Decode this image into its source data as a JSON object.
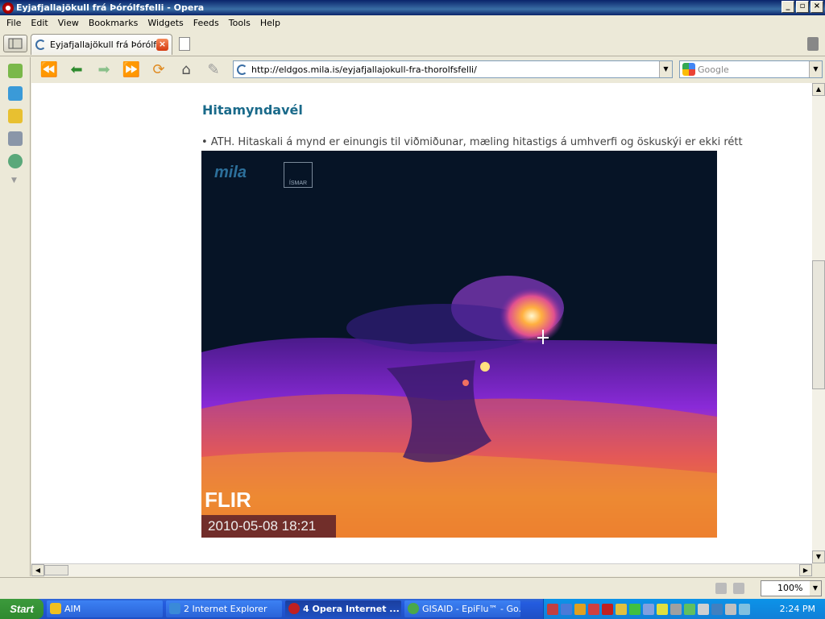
{
  "window": {
    "title": "Eyjafjallajökull frá Þórólfsfelli - Opera"
  },
  "menu": [
    "File",
    "Edit",
    "View",
    "Bookmarks",
    "Widgets",
    "Feeds",
    "Tools",
    "Help"
  ],
  "tab": {
    "label": "Eyjafjallajökull frá Þórólf..."
  },
  "address": {
    "url": "http://eldgos.mila.is/eyjafjallajokull-fra-thorolfsfelli/"
  },
  "search": {
    "placeholder": "Google"
  },
  "page": {
    "heading": "Hitamyndavél",
    "note": "• ATH. Hitaskali á mynd er einungis til viðmiðunar, mæling hitastigs á umhverfi og öskuskýi er ekki rétt",
    "image": {
      "logo": "mila",
      "logo2": "ÍSMAR",
      "brand": "FLIR",
      "timestamp": "2010-05-08 18:21"
    }
  },
  "status": {
    "zoom": "100%"
  },
  "taskbar": {
    "start": "Start",
    "buttons": [
      "AIM",
      "2 Internet Explorer",
      "4 Opera Internet ...",
      "GISAID - EpiFlu™ - Go..."
    ],
    "clock": "2:24 PM"
  },
  "colors": {
    "heading": "#1a6a8a",
    "titlebar": "#0a246a"
  }
}
